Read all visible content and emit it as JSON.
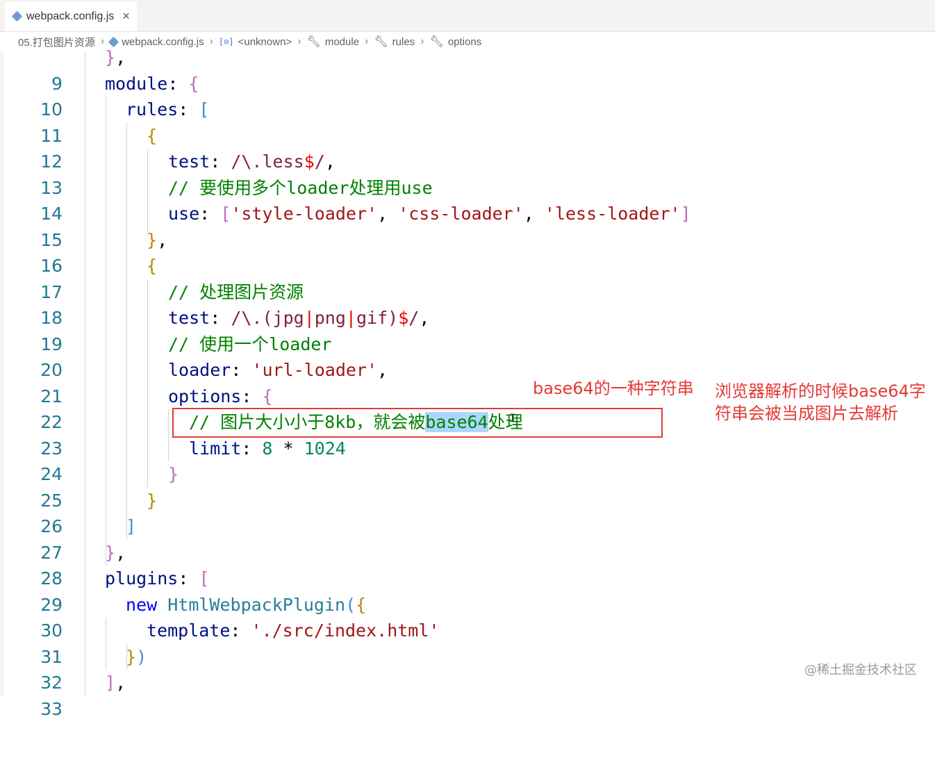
{
  "tab": {
    "filename": "webpack.config.js",
    "close_glyph": "×",
    "icon": "webpack-cube-icon"
  },
  "breadcrumb": {
    "items": [
      {
        "label": "05.打包图片资源",
        "icon": ""
      },
      {
        "label": "webpack.config.js",
        "icon": "webpack-cube-icon"
      },
      {
        "label": "<unknown>",
        "icon": "variable-icon",
        "icon_glyph": "[⊙]"
      },
      {
        "label": "module",
        "icon": "wrench-icon"
      },
      {
        "label": "rules",
        "icon": "wrench-icon"
      },
      {
        "label": "options",
        "icon": "wrench-icon"
      }
    ],
    "separator": "›"
  },
  "editor": {
    "line_numbers": [
      "9",
      "10",
      "11",
      "12",
      "13",
      "14",
      "15",
      "16",
      "17",
      "18",
      "19",
      "20",
      "21",
      "22",
      "23",
      "24",
      "25",
      "26",
      "27",
      "28",
      "29",
      "30",
      "31",
      "32",
      "33"
    ],
    "tokens": {
      "l9": [
        "}",
        ","
      ],
      "l10": [
        "module",
        ": ",
        "{"
      ],
      "l11": [
        "rules",
        ": ",
        "["
      ],
      "l12": [
        "{"
      ],
      "l13": [
        "test",
        ": ",
        "/\\.less",
        "$",
        "/",
        ","
      ],
      "l14": [
        "// ",
        "要使用多个",
        "loader",
        "处理用",
        "use"
      ],
      "l15": [
        "use",
        ": ",
        "[",
        "'style-loader'",
        ", ",
        "'css-loader'",
        ", ",
        "'less-loader'",
        "]"
      ],
      "l16": [
        "}",
        ","
      ],
      "l17": [
        "{"
      ],
      "l18": [
        "// ",
        "处理图片资源"
      ],
      "l19": [
        "test",
        ": ",
        "/\\.(jpg",
        "|",
        "png",
        "|",
        "gif)",
        "$",
        "/",
        ","
      ],
      "l20": [
        "// ",
        "使用一个",
        "loader"
      ],
      "l21": [
        "loader",
        ": ",
        "'url-loader'",
        ","
      ],
      "l22": [
        "options",
        ": ",
        "{"
      ],
      "l23": [
        "// ",
        "图片大小小于",
        "8kb",
        "，就会被",
        "base64",
        "处理"
      ],
      "l24": [
        "limit",
        ": ",
        "8",
        " * ",
        "1024"
      ],
      "l25": [
        "}"
      ],
      "l26": [
        "}"
      ],
      "l27": [
        "]"
      ],
      "l28": [
        "}",
        ","
      ],
      "l29": [
        "plugins",
        ": ",
        "["
      ],
      "l30": [
        "new",
        " ",
        "HtmlWebpackPlugin",
        "(",
        "{"
      ],
      "l31": [
        "template",
        ": ",
        "'./src/index.html'"
      ],
      "l32": [
        "}",
        ")"
      ],
      "l33": [
        "]",
        ","
      ]
    },
    "selected_text": "base64"
  },
  "annotations": {
    "note1": "base64的一种字符串",
    "note2_line1": "浏览器解析的时候base64字",
    "note2_line2": "符串会被当成图片去解析"
  },
  "watermark": "@稀土掘金技术社区",
  "colors": {
    "line_number": "#237893",
    "property": "#001080",
    "string": "#a31515",
    "comment": "#008000",
    "number": "#098658",
    "annotation_red": "#e53935",
    "selection": "#add6ff"
  }
}
